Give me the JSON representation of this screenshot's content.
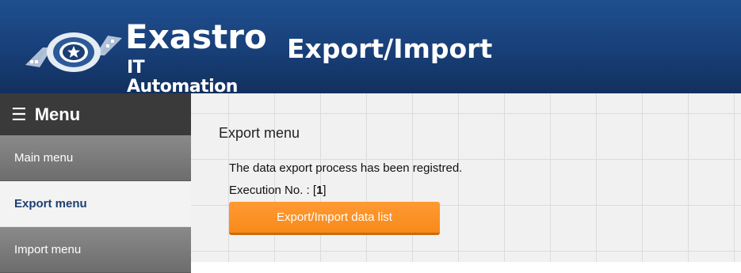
{
  "header": {
    "logo_name": "Exastro",
    "logo_sub": "IT Automation",
    "title": "Export/Import"
  },
  "sidebar": {
    "menu_label": "Menu",
    "items": [
      {
        "label": "Main menu",
        "active": false
      },
      {
        "label": "Export menu",
        "active": true
      },
      {
        "label": "Import menu",
        "active": false
      }
    ]
  },
  "main": {
    "title": "Export menu",
    "message": "The data export process has been registred.",
    "execution_label": "Execution No. : [",
    "execution_no": "1",
    "execution_suffix": "]",
    "button_label": "Export/Import data list"
  },
  "colors": {
    "header": "#183f78",
    "accent_button": "#f88a1a",
    "active_menu_text": "#1d3f72"
  },
  "icons": {
    "logo": "exastro-star-logo-icon",
    "menu": "hamburger-icon"
  }
}
